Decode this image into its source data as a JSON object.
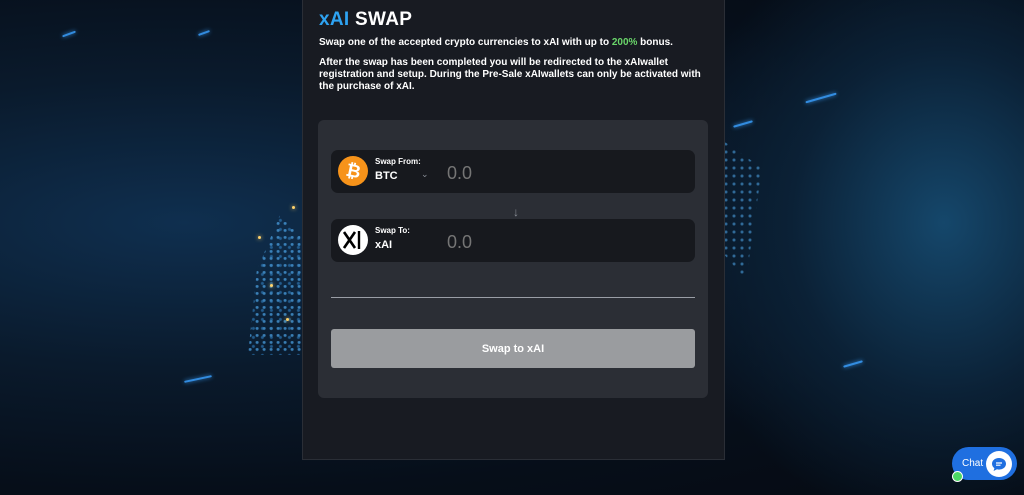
{
  "header": {
    "title_accent": "xAI",
    "title_rest": " SWAP"
  },
  "intro": {
    "line_before": "Swap one of the accepted crypto currencies to xAI with up to ",
    "bonus": "200%",
    "line_after": " bonus.",
    "note": "After the swap has been completed you will be redirected to the xAIwallet registration and setup. During the Pre-Sale xAIwallets can only be activated with the purchase of xAI."
  },
  "swap_from": {
    "label": "Swap From:",
    "token": "BTC",
    "amount_placeholder": "0.0",
    "icon": "bitcoin-icon"
  },
  "swap_to": {
    "label": "Swap To:",
    "token": "xAI",
    "amount_placeholder": "0.0",
    "icon": "xai-logo-icon"
  },
  "arrow_glyph": "↓",
  "swap_button_label": "Swap to xAI",
  "chat": {
    "label": "Chat"
  },
  "colors": {
    "accent": "#2ea3f2",
    "bonus": "#6ad66a",
    "panel": "#181b22",
    "card": "#2b2e35",
    "button_disabled": "#9a9c9f",
    "chat": "#1f6fe0",
    "bitcoin": "#f7931a"
  }
}
